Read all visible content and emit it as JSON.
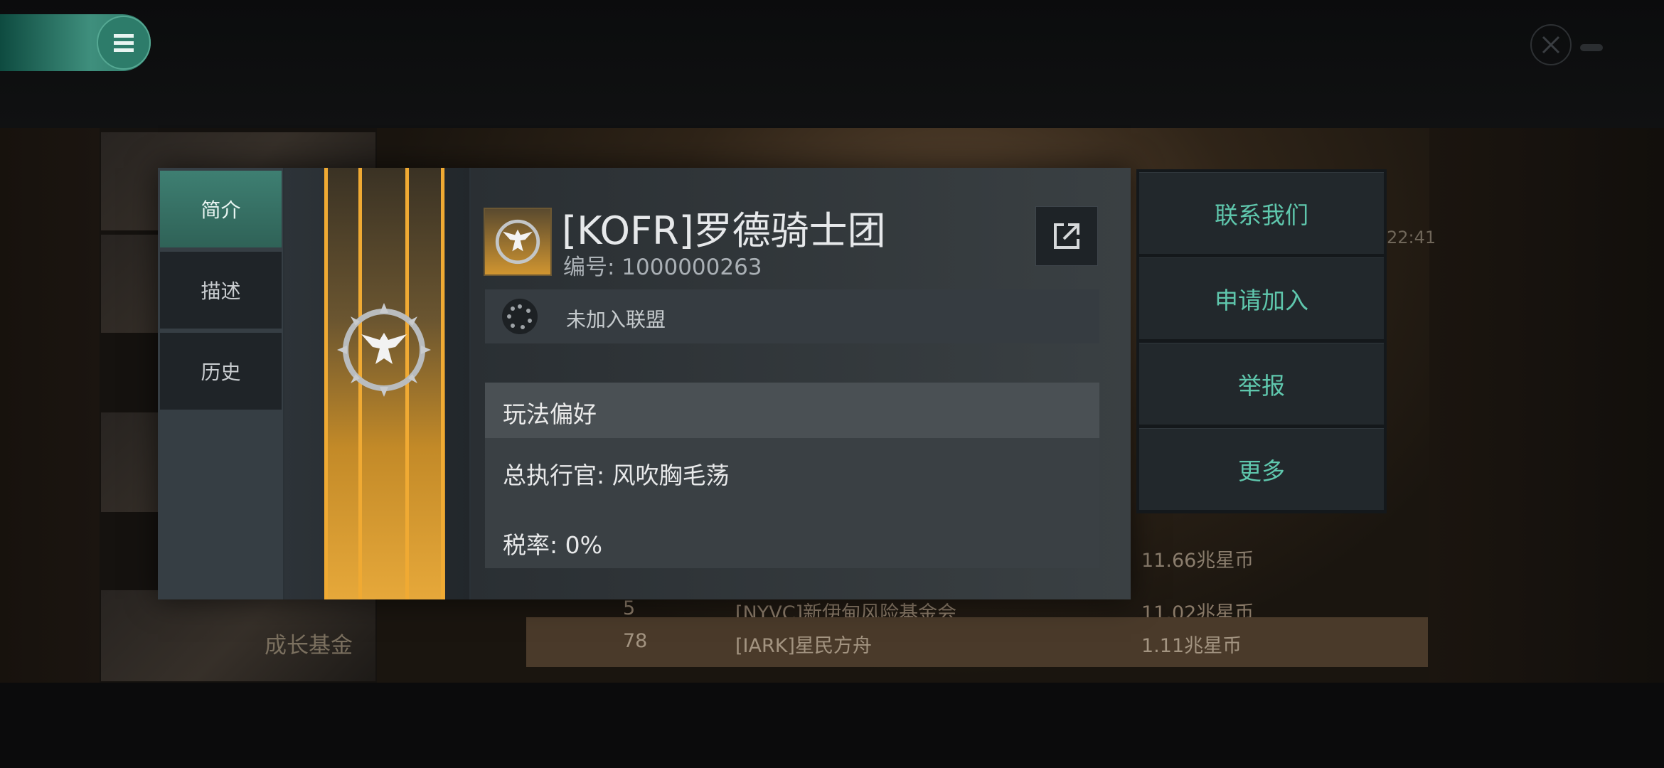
{
  "background": {
    "side_label": "成长基金",
    "time_fragment": "22:41",
    "amount_1": "11.66兆星币",
    "rows": [
      {
        "rank": "5",
        "name": "[NYVC]新伊甸风险基金会",
        "amount": "11.02兆星币"
      },
      {
        "rank": "78",
        "name": "[IARK]星民方舟",
        "amount": "1.11兆星币"
      }
    ]
  },
  "tabs": [
    {
      "label": "简介"
    },
    {
      "label": "描述"
    },
    {
      "label": "历史"
    }
  ],
  "corp": {
    "name": "[KOFR]罗德骑士团",
    "id_label": "编号",
    "id_value": "1000000263",
    "id_text": "编号: 1000000263",
    "alliance": "未加入联盟"
  },
  "preferences": {
    "title": "玩法偏好",
    "ceo": "总执行官: 风吹胸毛荡",
    "tax": "税率: 0%"
  },
  "actions": {
    "contact": "联系我们",
    "apply": "申请加入",
    "report": "举报",
    "more": "更多"
  },
  "colors": {
    "accent": "#5fc7ad",
    "banner_gold": "#e6a83a",
    "menu_teal": "#3f8f7d"
  },
  "icons": [
    "menu-icon",
    "close-icon",
    "eagle-emblem-icon",
    "share-icon",
    "alliance-icon"
  ]
}
